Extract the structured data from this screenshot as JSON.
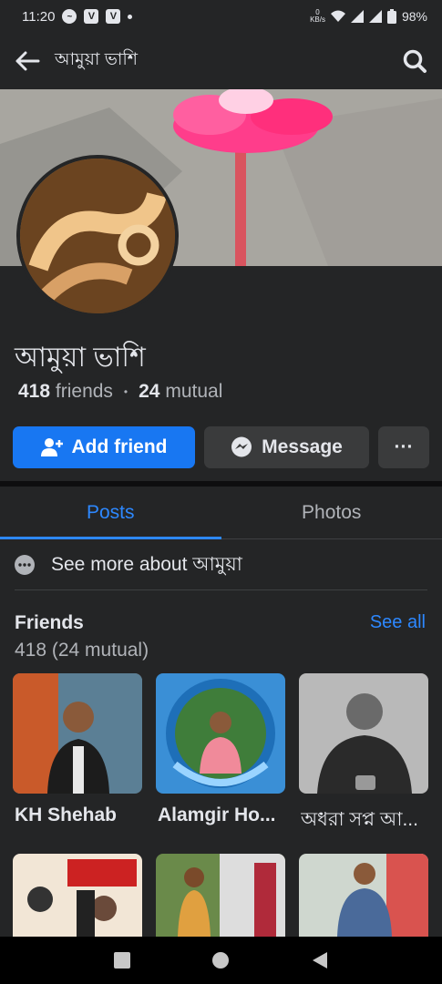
{
  "status_bar": {
    "time": "11:20",
    "net_speed": "0\nKB/s",
    "battery": "98%"
  },
  "header": {
    "title": "আমুয়া ভাশি"
  },
  "profile": {
    "name": "আমুয়া ভাশি",
    "friends_count": "418",
    "friends_label": "friends",
    "mutual_count": "24",
    "mutual_label": "mutual"
  },
  "actions": {
    "add_friend": "Add friend",
    "message": "Message",
    "more": "···"
  },
  "tabs": [
    {
      "label": "Posts",
      "active": true
    },
    {
      "label": "Photos",
      "active": false
    }
  ],
  "about": {
    "text": "See more about আমুয়া"
  },
  "friends": {
    "heading": "Friends",
    "see_all": "See all",
    "count": "418 (24 mutual)",
    "items": [
      {
        "name": "KH Shehab"
      },
      {
        "name": "Alamgir Ho..."
      },
      {
        "name": "অধরা সপ্ন আ..."
      },
      {
        "name": ""
      },
      {
        "name": ""
      },
      {
        "name": ""
      }
    ]
  },
  "colors": {
    "accent": "#1877f2",
    "link": "#2d88ff",
    "bg": "#18191a",
    "surface": "#242526"
  }
}
